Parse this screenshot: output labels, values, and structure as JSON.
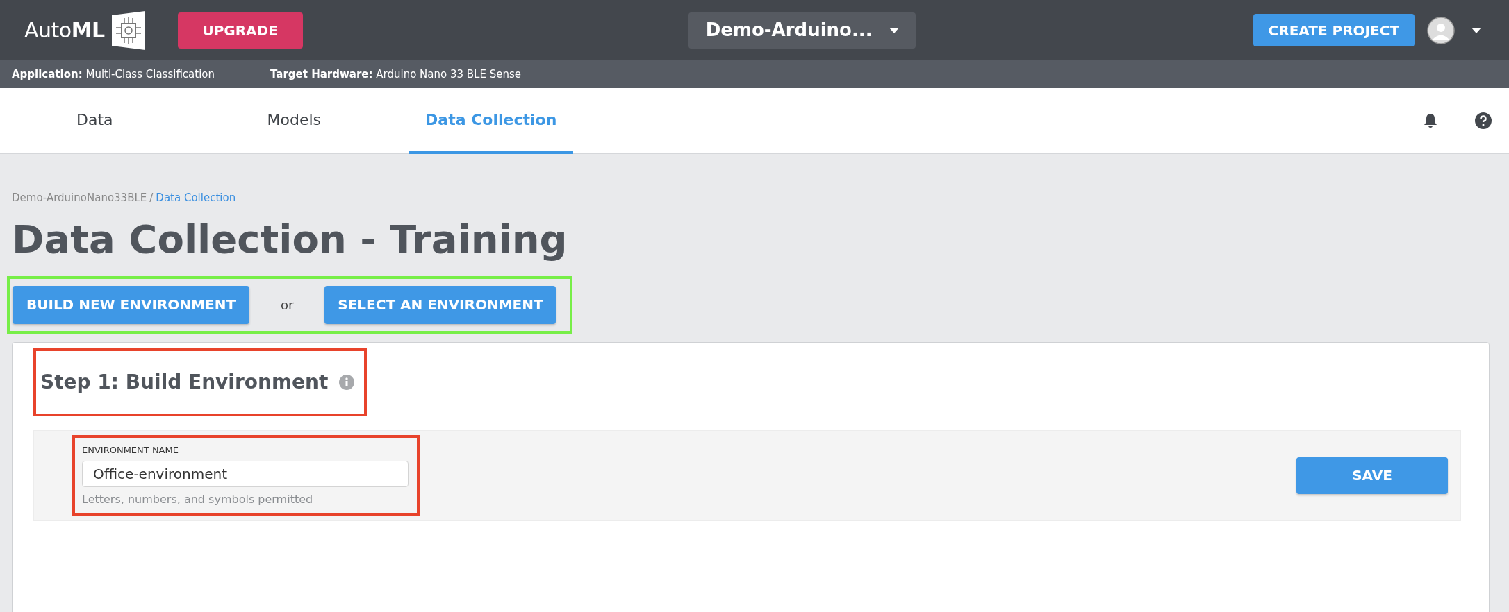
{
  "header": {
    "logo": {
      "text": "Auto",
      "bold": "ML"
    },
    "upgrade_button": "UPGRADE",
    "project_dropdown": "Demo-Arduino...",
    "create_button": "CREATE PROJECT"
  },
  "info_bar": [
    {
      "label": "Application:",
      "value": "Multi-Class Classification"
    },
    {
      "label": "Target Hardware:",
      "value": "Arduino Nano 33 BLE Sense"
    }
  ],
  "tabs": [
    {
      "label": "Data",
      "selected": false
    },
    {
      "label": "Models",
      "selected": false
    },
    {
      "label": "Data Collection",
      "selected": true
    }
  ],
  "breadcrumb": [
    {
      "label": "Demo-ArduinoNano33BLE",
      "current": false
    },
    {
      "label": "Data Collection",
      "current": true
    }
  ],
  "breadcrumb_separator": "/",
  "title": "Data Collection - Training",
  "actions": {
    "build_button": "BUILD NEW ENVIRONMENT",
    "separator": "or",
    "select_button": "SELECT AN ENVIRONMENT"
  },
  "step": {
    "heading": "Step 1: Build Environment",
    "field": {
      "label": "ENVIRONMENT NAME",
      "value": "Office-environment",
      "help": "Letters, numbers, and symbols permitted"
    },
    "save_button": "SAVE"
  }
}
